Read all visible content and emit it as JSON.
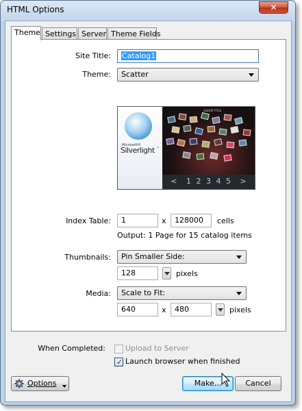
{
  "window": {
    "title": "HTML Options",
    "close_glyph": "✕"
  },
  "tabs": [
    "Theme",
    "Settings",
    "Server",
    "Theme Fields"
  ],
  "theme_tab": {
    "site_title_label": "Site Title:",
    "site_title_value": "Catalog1",
    "theme_label": "Theme:",
    "theme_value": "Scatter",
    "preview": {
      "ms_text": "Microsoft®",
      "brand_text": "Silverlight",
      "tm_text": "™",
      "album_title": "ALBUM TITLE",
      "pager_prev": "<",
      "pages": [
        "1",
        "2",
        "3",
        "4",
        "5"
      ],
      "pager_next": ">"
    },
    "index_table_label": "Index Table:",
    "index_cols": "1",
    "times_sign": "x",
    "index_rows": "128000",
    "cells_label": "cells",
    "output_text": "Output: 1 Page for 15 catalog items",
    "thumbnails_label": "Thumbnails:",
    "thumbnails_mode": "Pin Smaller Side:",
    "thumbnail_size": "128",
    "pixels_label": "pixels",
    "media_label": "Media:",
    "media_mode": "Scale to Fit:",
    "media_width": "640",
    "media_height": "480"
  },
  "footer": {
    "when_completed_label": "When Completed:",
    "upload_label": "Upload to Server",
    "upload_checked": false,
    "launch_label": "Launch browser when finished",
    "launch_checked": true,
    "options_button": "Options",
    "make_button": "Make...",
    "cancel_button": "Cancel"
  },
  "icons": {
    "gear": "gear-icon",
    "dropdown": "chevron-down-icon",
    "check": "checkmark-icon",
    "cursor": "mouse-pointer-icon"
  },
  "colors": {
    "accent": "#3399ff",
    "titlebar": "#c9dbef",
    "close": "#c8432a"
  }
}
